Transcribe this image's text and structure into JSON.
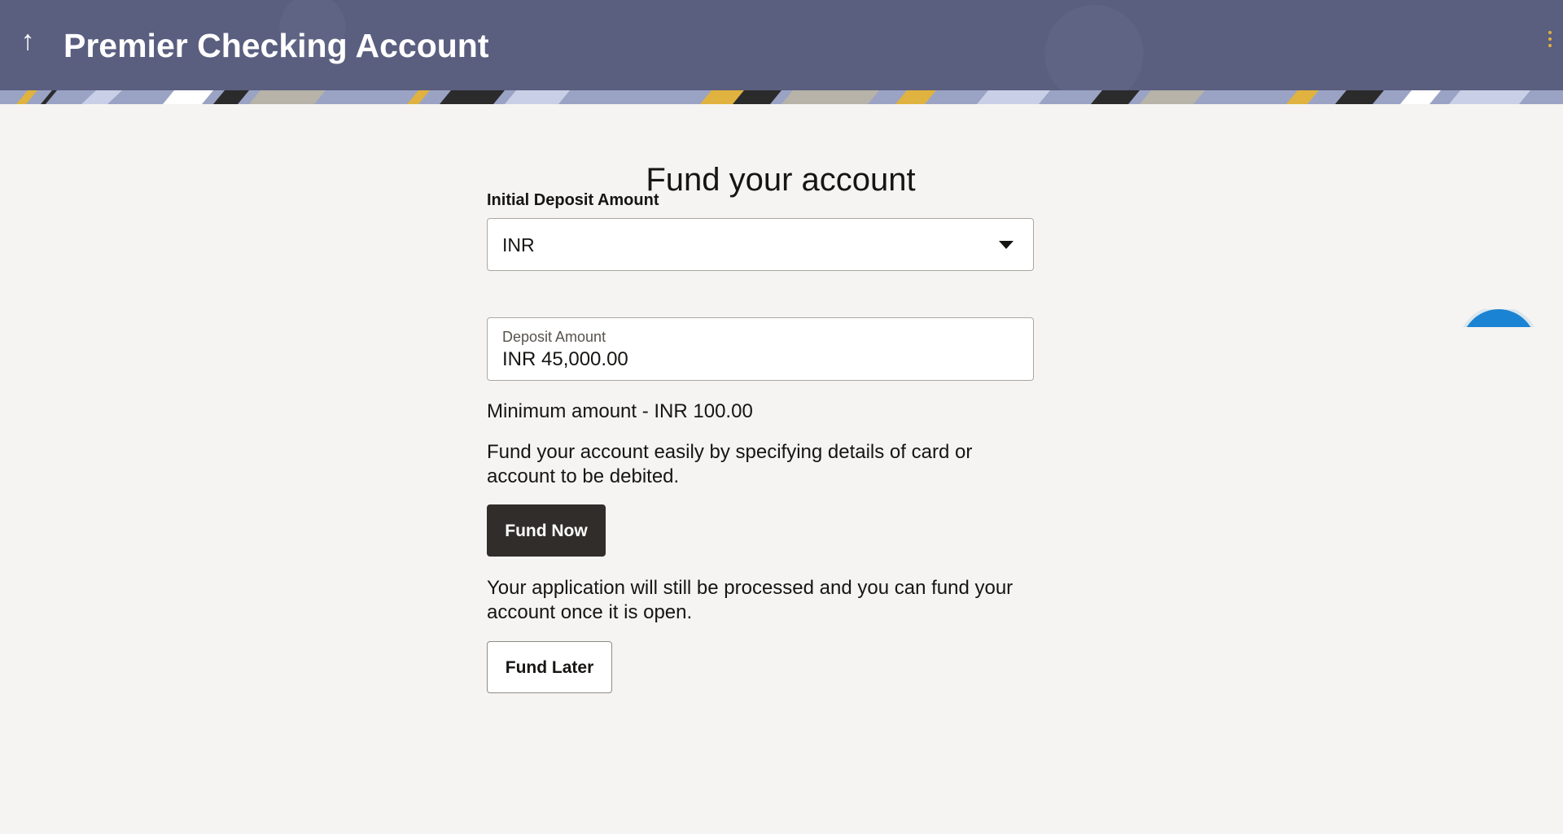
{
  "header": {
    "title": "Premier Checking Account",
    "back_icon": "↑",
    "menu_icon": "kebab-icon",
    "accent_color": "#e2b13c",
    "background_color": "#5a5e7f"
  },
  "main": {
    "title": "Fund your account",
    "initial_deposit": {
      "label": "Initial Deposit Amount",
      "currency_selected": "INR"
    },
    "deposit_amount": {
      "label": "Deposit Amount",
      "value": "INR 45,000.00"
    },
    "minimum_amount_text": "Minimum amount - INR 100.00",
    "fund_now_text": "Fund your account easily by specifying details of card or account to be debited.",
    "fund_now_label": "Fund Now",
    "fund_later_text": "Your application will still be processed and you can fund your account once it is open.",
    "fund_later_label": "Fund Later"
  },
  "colors": {
    "primary_button": "#312d2a",
    "fab": "#1b83d3",
    "page_background": "#f5f4f2"
  }
}
